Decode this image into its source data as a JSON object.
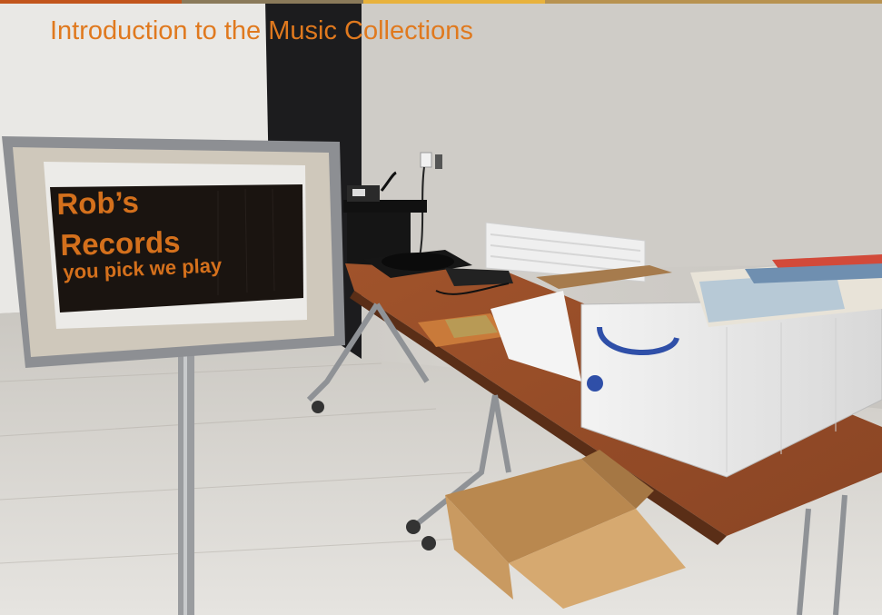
{
  "slide": {
    "title": "Introduction to the Music Collections"
  },
  "sign": {
    "line1": "Rob’s",
    "line2": "Records",
    "line3": "you pick we play"
  },
  "colors": {
    "accent": "#e0791e",
    "sign_text": "#d4701c",
    "sign_panel": "#1a1410"
  }
}
